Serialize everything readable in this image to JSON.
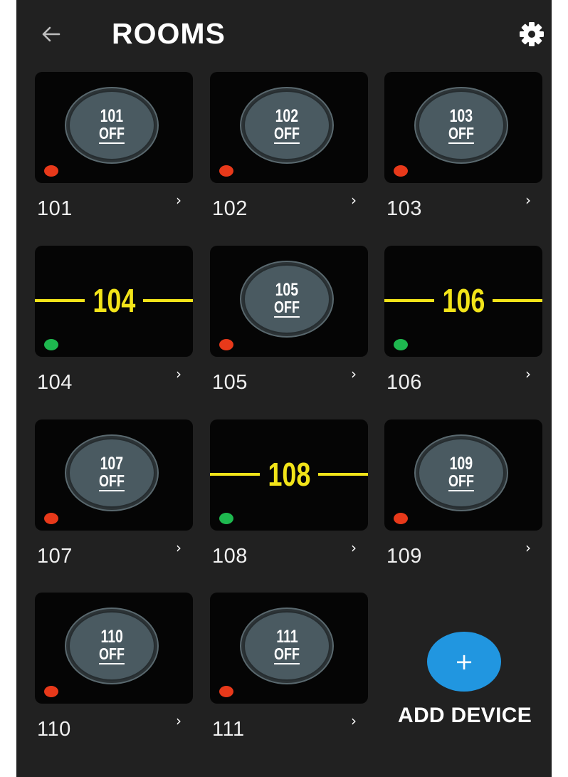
{
  "header": {
    "title": "ROOMS",
    "back_icon": "arrow-left-icon",
    "settings_icon": "gear-icon"
  },
  "colors": {
    "background": "#212121",
    "thumb": "#050505",
    "oval": "#4a5a61",
    "line": "#f2e419",
    "status_off": "#e8391a",
    "status_on": "#1eb84f",
    "accent": "#2196e0"
  },
  "rooms": [
    {
      "label": "101",
      "thumb_number": "101",
      "thumb_state": "OFF",
      "style": "oval",
      "status": "off"
    },
    {
      "label": "102",
      "thumb_number": "102",
      "thumb_state": "OFF",
      "style": "oval",
      "status": "off"
    },
    {
      "label": "103",
      "thumb_number": "103",
      "thumb_state": "OFF",
      "style": "oval",
      "status": "off"
    },
    {
      "label": "104",
      "thumb_number": "104",
      "thumb_state": "",
      "style": "line",
      "status": "on"
    },
    {
      "label": "105",
      "thumb_number": "105",
      "thumb_state": "OFF",
      "style": "oval",
      "status": "off"
    },
    {
      "label": "106",
      "thumb_number": "106",
      "thumb_state": "",
      "style": "line",
      "status": "on"
    },
    {
      "label": "107",
      "thumb_number": "107",
      "thumb_state": "OFF",
      "style": "oval",
      "status": "off"
    },
    {
      "label": "108",
      "thumb_number": "108",
      "thumb_state": "",
      "style": "line",
      "status": "on"
    },
    {
      "label": "109",
      "thumb_number": "109",
      "thumb_state": "OFF",
      "style": "oval",
      "status": "off"
    },
    {
      "label": "110",
      "thumb_number": "110",
      "thumb_state": "OFF",
      "style": "oval",
      "status": "off"
    },
    {
      "label": "111",
      "thumb_number": "111",
      "thumb_state": "OFF",
      "style": "oval",
      "status": "off"
    }
  ],
  "room_chevron": "›",
  "add_device": {
    "icon": "plus-icon",
    "symbol": "+",
    "label": "ADD DEVICE"
  }
}
